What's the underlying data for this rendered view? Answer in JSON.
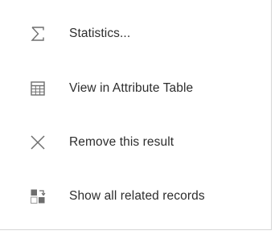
{
  "menu": {
    "items": [
      {
        "label": "Statistics...",
        "icon": "sigma-icon"
      },
      {
        "label": "View in Attribute Table",
        "icon": "table-icon"
      },
      {
        "label": "Remove this result",
        "icon": "close-icon"
      },
      {
        "label": "Show all related records",
        "icon": "related-records-icon"
      }
    ]
  },
  "colors": {
    "text": "#2d2d2d",
    "icon": "#6e6e6e",
    "border": "#d6d6d6",
    "background": "#ffffff"
  }
}
